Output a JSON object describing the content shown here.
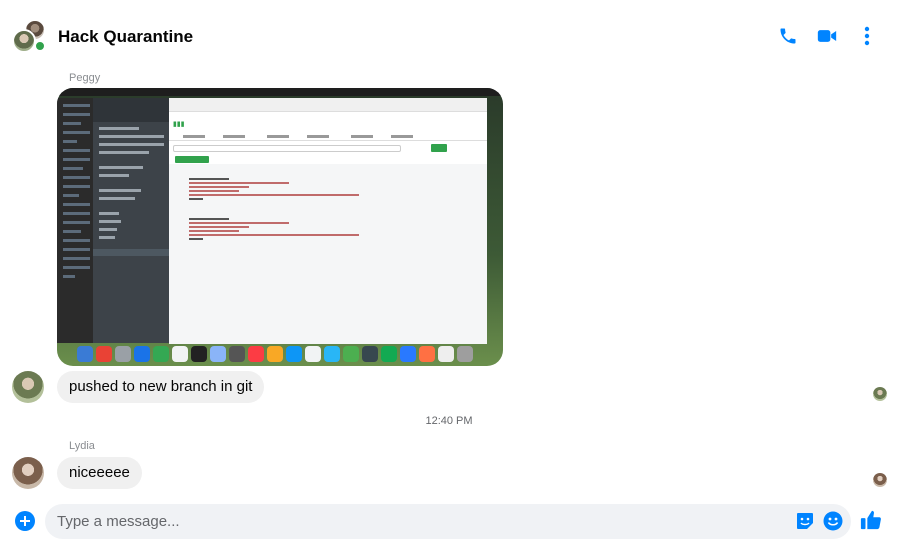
{
  "header": {
    "title": "Hack Quarantine",
    "icons": [
      "phone-icon",
      "video-icon",
      "more-options-icon"
    ]
  },
  "messages": [
    {
      "sender": "Peggy",
      "type": "image"
    },
    {
      "sender": "Peggy",
      "type": "text",
      "text": "pushed to new branch in git"
    },
    {
      "sender": "Lydia",
      "type": "text",
      "text": "niceeeee"
    }
  ],
  "timestamp": "12:40 PM",
  "composer": {
    "placeholder": "Type a message..."
  },
  "colors": {
    "accent": "#0084ff",
    "bubble": "#f0f0f0",
    "online": "#31a24c"
  }
}
